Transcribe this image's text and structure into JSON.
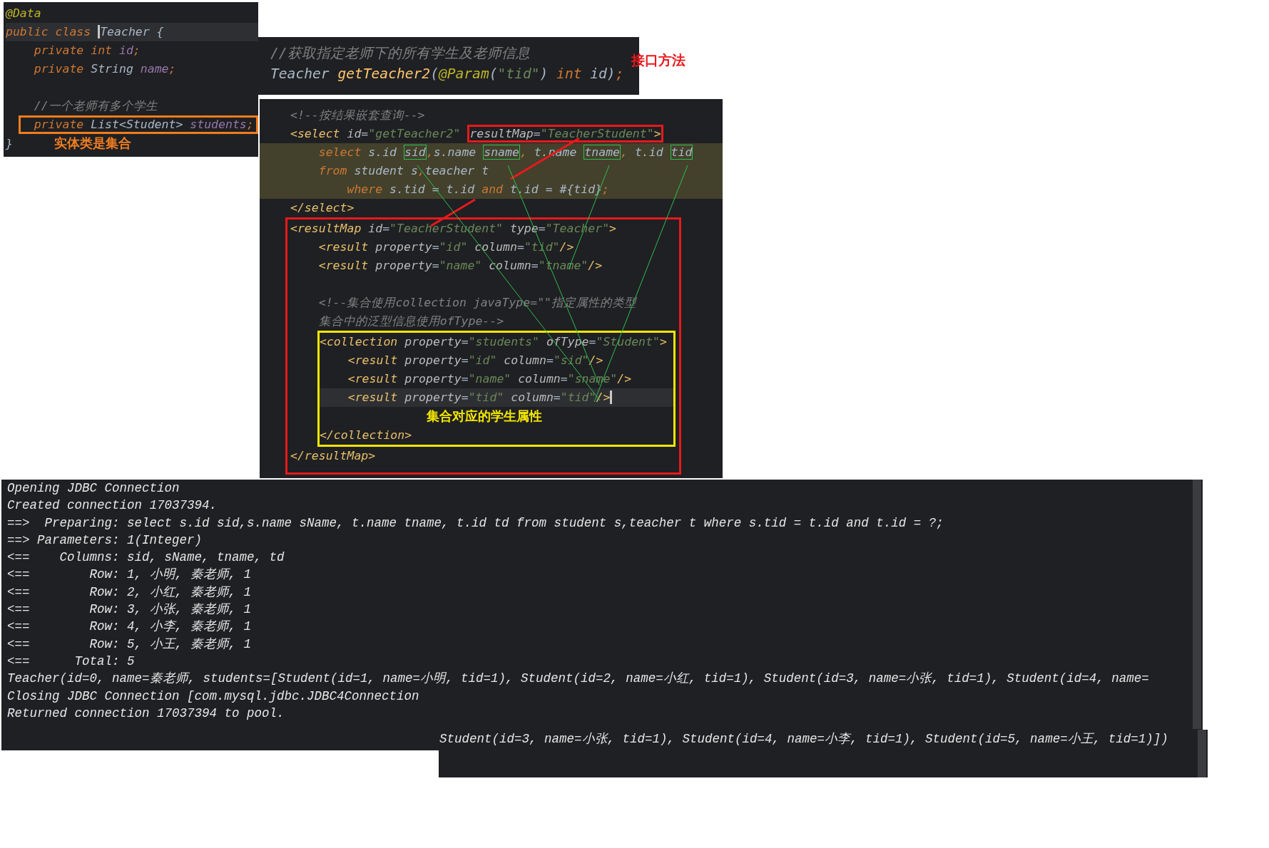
{
  "entity_panel": {
    "lines": [
      {
        "current": false,
        "tokens": [
          {
            "text": "@Data",
            "kind": "annotation"
          }
        ]
      },
      {
        "current": true,
        "tokens": [
          {
            "text": "public class ",
            "kind": "keyword"
          },
          {
            "kind": "caret"
          },
          {
            "text": "Teacher",
            "kind": "type"
          },
          {
            "text": " {",
            "kind": "plain"
          }
        ]
      },
      {
        "current": false,
        "tokens": [
          {
            "text": "    private int ",
            "kind": "keyword"
          },
          {
            "text": "id",
            "kind": "field"
          },
          {
            "text": ";",
            "kind": "keyword"
          }
        ]
      },
      {
        "current": false,
        "tokens": [
          {
            "text": "    private ",
            "kind": "keyword"
          },
          {
            "text": "String ",
            "kind": "type"
          },
          {
            "text": "name",
            "kind": "field"
          },
          {
            "text": ";",
            "kind": "keyword"
          }
        ]
      },
      {
        "current": false
      },
      {
        "current": false,
        "tokens": [
          {
            "text": "    //一个老师有多个学生",
            "kind": "comment"
          }
        ]
      },
      {
        "current": false,
        "color": "#f07d1f",
        "tokens": [
          {
            "text": "    private ",
            "kind": "keyword"
          },
          {
            "text": "List<Student> ",
            "kind": "type"
          },
          {
            "text": "students",
            "kind": "field"
          },
          {
            "text": ";",
            "kind": "keyword"
          }
        ]
      },
      {
        "current": false,
        "tokens": [
          {
            "text": "}",
            "kind": "plain"
          }
        ],
        "note": {
          "text": "实体类是集合",
          "color": "#f07d1f"
        }
      }
    ]
  },
  "mapper_interface_panel": {
    "lines": [
      {
        "tokens": [
          {
            "text": "//获取指定老师下的所有学生及老师信息",
            "kind": "comment"
          }
        ]
      },
      {
        "tokens": [
          {
            "text": "Teacher ",
            "kind": "type"
          },
          {
            "text": "getTeacher2",
            "kind": "method"
          },
          {
            "text": "(",
            "kind": "plain"
          },
          {
            "text": "@Param",
            "kind": "annotation"
          },
          {
            "text": "(",
            "kind": "plain"
          },
          {
            "text": "\"tid\"",
            "kind": "string"
          },
          {
            "text": ") ",
            "kind": "plain"
          },
          {
            "text": "int ",
            "kind": "keyword"
          },
          {
            "text": "id)",
            "kind": "plain"
          },
          {
            "text": ";",
            "kind": "keyword"
          }
        ]
      }
    ],
    "note": {
      "text": "接口方法",
      "color": "#e8191c"
    }
  },
  "mapper_xml_panel": {
    "items": [
      {
        "kind": "line",
        "current": false,
        "tokens": [
          {
            "text": "<!--按结果嵌套查询-->",
            "kind": "comment"
          }
        ]
      },
      {
        "kind": "line",
        "current": false,
        "tokens": [
          {
            "text": "<select ",
            "kind": "tag"
          },
          {
            "text": "id",
            "kind": "attr"
          },
          {
            "text": "=",
            "kind": "plain"
          },
          {
            "text": "\"getTeacher2\" ",
            "kind": "string"
          },
          {
            "color": "#e8191c",
            "tokens": [
              {
                "text": "resultMap",
                "kind": "attr"
              },
              {
                "text": "=",
                "kind": "plain"
              },
              {
                "text": "\"TeacherStudent\"",
                "kind": "string"
              },
              {
                "text": ">",
                "kind": "tag"
              }
            ]
          }
        ]
      },
      {
        "kind": "injected",
        "items": [
          {
            "kind": "line",
            "current": false,
            "tokens": [
              {
                "text": "    select ",
                "kind": "keyword"
              },
              {
                "text": "s.id ",
                "kind": "plain"
              },
              {
                "color": "#2fbf4f",
                "tokens": [
                  {
                    "text": "sid",
                    "kind": "plain"
                  }
                ]
              },
              {
                "text": ",",
                "kind": "keyword"
              },
              {
                "text": "s.name ",
                "kind": "plain"
              },
              {
                "color": "#2fbf4f",
                "tokens": [
                  {
                    "text": "sname",
                    "kind": "plain"
                  }
                ]
              },
              {
                "text": ",",
                "kind": "keyword"
              },
              {
                "text": " t.name ",
                "kind": "plain"
              },
              {
                "color": "#2fbf4f",
                "tokens": [
                  {
                    "text": "tname",
                    "kind": "plain"
                  }
                ]
              },
              {
                "text": ",",
                "kind": "keyword"
              },
              {
                "text": " t.id ",
                "kind": "plain"
              },
              {
                "color": "#2fbf4f",
                "tokens": [
                  {
                    "text": "tid",
                    "kind": "plain"
                  }
                ]
              }
            ]
          },
          {
            "kind": "line",
            "current": false,
            "tokens": [
              {
                "text": "    from ",
                "kind": "keyword"
              },
              {
                "text": "student s",
                "kind": "plain"
              },
              {
                "text": ",",
                "kind": "keyword"
              },
              {
                "text": "teacher t",
                "kind": "plain"
              }
            ]
          },
          {
            "kind": "line",
            "current": false,
            "tokens": [
              {
                "text": "        where ",
                "kind": "keyword"
              },
              {
                "text": "s.tid = t.id ",
                "kind": "plain"
              },
              {
                "text": "and ",
                "kind": "keyword"
              },
              {
                "text": "t.id = #{tid}",
                "kind": "plain"
              },
              {
                "text": ";",
                "kind": "keyword"
              }
            ]
          }
        ]
      },
      {
        "kind": "line",
        "current": false,
        "tokens": [
          {
            "text": "</select>",
            "kind": "tag"
          }
        ]
      },
      {
        "kind": "frame",
        "color": "#e8191c",
        "items": [
          {
            "kind": "line",
            "current": false,
            "tokens": [
              {
                "text": "<resultMap ",
                "kind": "tag"
              },
              {
                "text": "id",
                "kind": "attr"
              },
              {
                "text": "=",
                "kind": "plain"
              },
              {
                "text": "\"TeacherStudent\"",
                "kind": "string"
              },
              {
                "text": " type",
                "kind": "attr"
              },
              {
                "text": "=",
                "kind": "plain"
              },
              {
                "text": "\"Teacher\"",
                "kind": "string"
              },
              {
                "text": ">",
                "kind": "tag"
              }
            ]
          },
          {
            "kind": "line",
            "current": false,
            "tokens": [
              {
                "text": "    <result ",
                "kind": "tag"
              },
              {
                "text": "property",
                "kind": "attr"
              },
              {
                "text": "=",
                "kind": "plain"
              },
              {
                "text": "\"id\"",
                "kind": "string"
              },
              {
                "text": " column",
                "kind": "attr"
              },
              {
                "text": "=",
                "kind": "plain"
              },
              {
                "text": "\"tid\"",
                "kind": "string"
              },
              {
                "text": "/>",
                "kind": "tag"
              }
            ]
          },
          {
            "kind": "line",
            "current": false,
            "tokens": [
              {
                "text": "    <result ",
                "kind": "tag"
              },
              {
                "text": "property",
                "kind": "attr"
              },
              {
                "text": "=",
                "kind": "plain"
              },
              {
                "text": "\"name\"",
                "kind": "string"
              },
              {
                "text": " column",
                "kind": "attr"
              },
              {
                "text": "=",
                "kind": "plain"
              },
              {
                "text": "\"tname\"",
                "kind": "string"
              },
              {
                "text": "/>",
                "kind": "tag"
              }
            ]
          },
          {
            "kind": "line",
            "current": false
          },
          {
            "kind": "line",
            "current": false,
            "tokens": [
              {
                "text": "    <!--集合使用collection javaType=\"\"指定属性的类型",
                "kind": "comment"
              }
            ]
          },
          {
            "kind": "line",
            "current": false,
            "tokens": [
              {
                "text": "    集合中的泛型信息使用ofType-->",
                "kind": "comment"
              }
            ]
          },
          {
            "kind": "frame",
            "color": "#f2e600",
            "items": [
              {
                "kind": "line",
                "current": false,
                "tokens": [
                  {
                    "text": "<collection ",
                    "kind": "tag"
                  },
                  {
                    "text": "property",
                    "kind": "attr"
                  },
                  {
                    "text": "=",
                    "kind": "plain"
                  },
                  {
                    "text": "\"students\"",
                    "kind": "string"
                  },
                  {
                    "text": " ofType",
                    "kind": "attr"
                  },
                  {
                    "text": "=",
                    "kind": "plain"
                  },
                  {
                    "text": "\"Student\"",
                    "kind": "string"
                  },
                  {
                    "text": ">",
                    "kind": "tag"
                  }
                ]
              },
              {
                "kind": "line",
                "current": false,
                "tokens": [
                  {
                    "text": "    <result ",
                    "kind": "tag"
                  },
                  {
                    "text": "property",
                    "kind": "attr"
                  },
                  {
                    "text": "=",
                    "kind": "plain"
                  },
                  {
                    "text": "\"id\"",
                    "kind": "string"
                  },
                  {
                    "text": " column",
                    "kind": "attr"
                  },
                  {
                    "text": "=",
                    "kind": "plain"
                  },
                  {
                    "text": "\"sid\"",
                    "kind": "string"
                  },
                  {
                    "text": "/>",
                    "kind": "tag"
                  }
                ]
              },
              {
                "kind": "line",
                "current": false,
                "tokens": [
                  {
                    "text": "    <result ",
                    "kind": "tag"
                  },
                  {
                    "text": "property",
                    "kind": "attr"
                  },
                  {
                    "text": "=",
                    "kind": "plain"
                  },
                  {
                    "text": "\"name\"",
                    "kind": "string"
                  },
                  {
                    "text": " column",
                    "kind": "attr"
                  },
                  {
                    "text": "=",
                    "kind": "plain"
                  },
                  {
                    "text": "\"sname\"",
                    "kind": "string"
                  },
                  {
                    "text": "/>",
                    "kind": "tag"
                  }
                ]
              },
              {
                "kind": "line",
                "current": true,
                "tokens": [
                  {
                    "text": "    <result ",
                    "kind": "tag"
                  },
                  {
                    "text": "property",
                    "kind": "attr"
                  },
                  {
                    "text": "=",
                    "kind": "plain"
                  },
                  {
                    "text": "\"tid\"",
                    "kind": "string"
                  },
                  {
                    "text": " column",
                    "kind": "attr"
                  },
                  {
                    "text": "=",
                    "kind": "plain"
                  },
                  {
                    "text": "\"tid\"",
                    "kind": "string"
                  },
                  {
                    "text": "/>",
                    "kind": "tag"
                  },
                  {
                    "kind": "caret"
                  }
                ]
              },
              {
                "kind": "line",
                "current": false,
                "note": {
                  "text": "集合对应的学生属性",
                  "color": "#f2e600"
                }
              },
              {
                "kind": "line",
                "current": false,
                "tokens": [
                  {
                    "text": "</collection>",
                    "kind": "tag"
                  }
                ]
              }
            ]
          },
          {
            "kind": "line",
            "current": false,
            "tokens": [
              {
                "text": "</resultMap>",
                "kind": "tag"
              }
            ]
          }
        ]
      }
    ]
  },
  "console": {
    "lines": [
      "Opening JDBC Connection",
      "Created connection 17037394.",
      "==>  Preparing: select s.id sid,s.name sName, t.name tname, t.id td from student s,teacher t where s.tid = t.id and t.id = ?;",
      "==> Parameters: 1(Integer)",
      "<==    Columns: sid, sName, tname, td",
      "<==        Row: 1, 小明, 秦老师, 1",
      "<==        Row: 2, 小红, 秦老师, 1",
      "<==        Row: 3, 小张, 秦老师, 1",
      "<==        Row: 4, 小李, 秦老师, 1",
      "<==        Row: 5, 小王, 秦老师, 1",
      "<==      Total: 5",
      "Teacher(id=0, name=秦老师, students=[Student(id=1, name=小明, tid=1), Student(id=2, name=小红, tid=1), Student(id=3, name=小张, tid=1), Student(id=4, name=",
      "Closing JDBC Connection [com.mysql.jdbc.JDBC4Connection",
      "Returned connection 17037394 to pool."
    ],
    "continuation": "Student(id=3, name=小张, tid=1), Student(id=4, name=小李, tid=1), Student(id=5, name=小王, tid=1)])"
  }
}
